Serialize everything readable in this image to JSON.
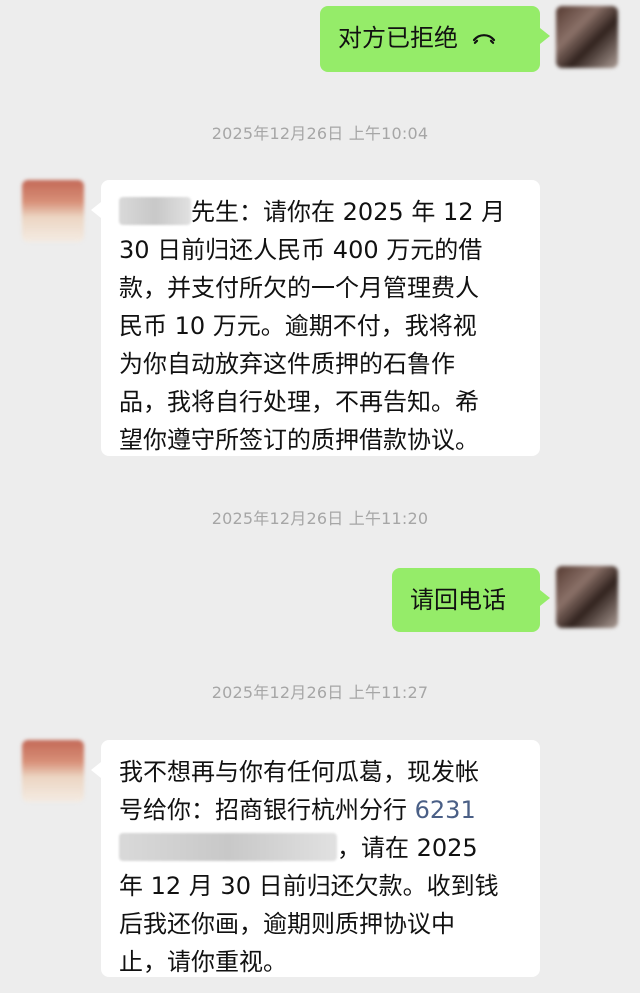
{
  "chat": {
    "message_1": {
      "text": "对方已拒绝"
    },
    "timestamp_1": "2025年12月26日 上午10:04",
    "message_2": {
      "suffix": "先生：请你在 2025 年 12 月\n30 日前归还人民币 400 万元的借\n款，并支付所欠的一个月管理费人\n民币 10 万元。逾期不付，我将视\n为你自动放弃这件质押的石鲁作\n品，我将自行处理，不再告知。希\n望你遵守所签订的质押借款协议。"
    },
    "timestamp_2": "2025年12月26日 上午11:20",
    "message_3": {
      "text": "请回电话"
    },
    "timestamp_3": "2025年12月26日 上午11:27",
    "message_4": {
      "line1": "我不想再与你有任何瓜葛，现发帐",
      "line2_prefix": "号给你：招商银行杭州分行 ",
      "account_visible": "6231",
      "line3_suffix": "，请在 2025",
      "line4": "年 12 月 30 日前归还欠款。收到钱",
      "line5": "后我还你画，逾期则质押协议中",
      "line6": "止，请你重视。"
    }
  },
  "icons": {
    "hangup": "phone-hangup-icon"
  },
  "colors": {
    "background": "#ededed",
    "outgoing_bubble": "#95ec69",
    "incoming_bubble": "#ffffff",
    "timestamp_text": "#a6a6a6",
    "account_link": "#4a5f86"
  }
}
